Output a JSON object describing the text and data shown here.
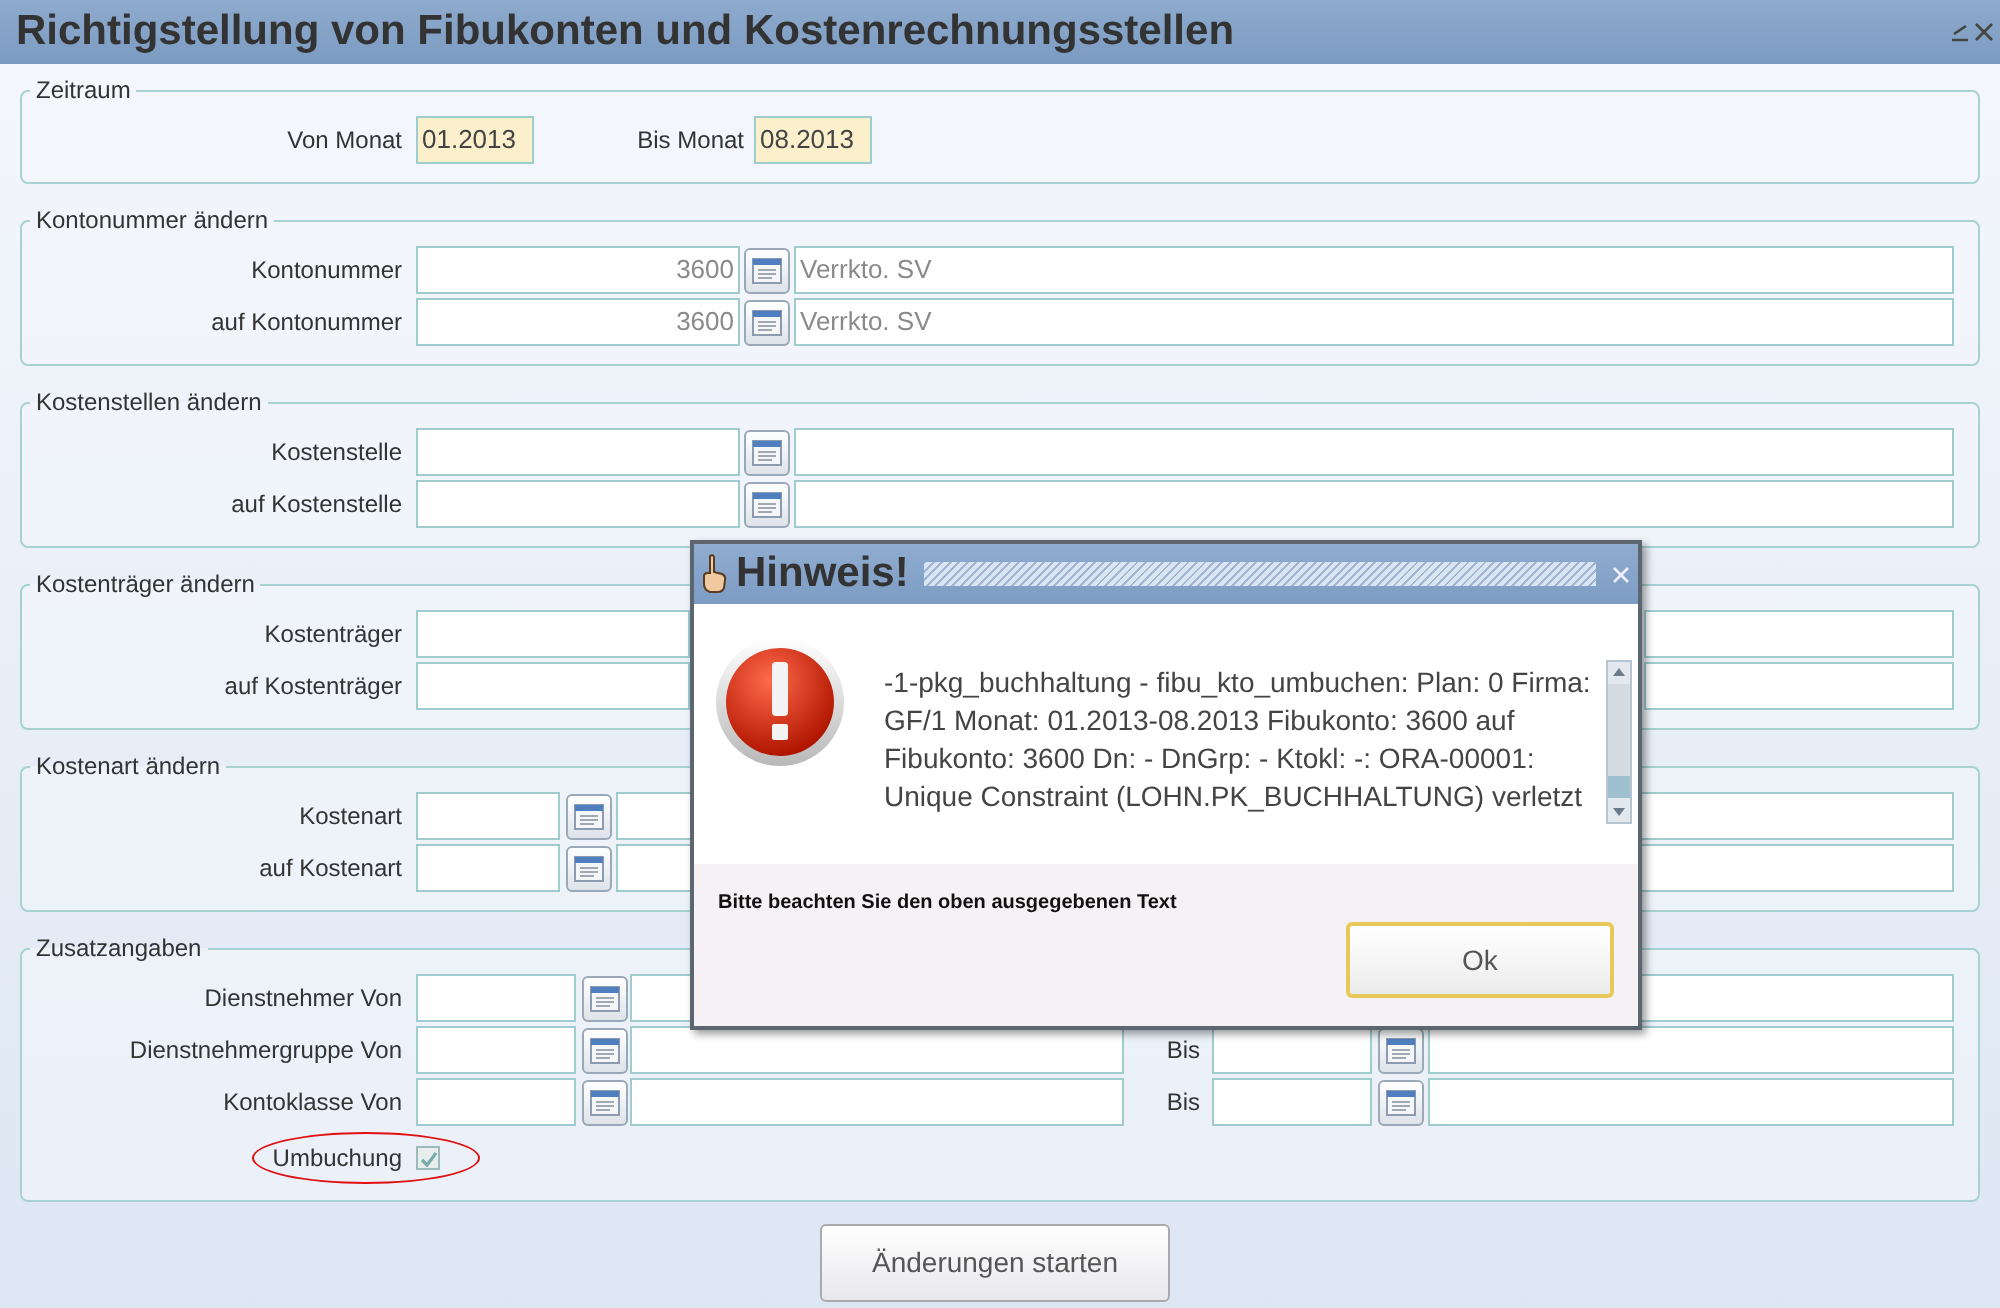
{
  "window": {
    "title": "Richtigstellung von Fibukonten und Kostenrechnungsstellen"
  },
  "period": {
    "legend": "Zeitraum",
    "from_label": "Von Monat",
    "from_value": "01.2013",
    "to_label": "Bis Monat",
    "to_value": "08.2013"
  },
  "sections": [
    {
      "legend": "Kontonummer ändern",
      "rows": [
        {
          "kind": "wide",
          "label": "Kontonummer",
          "code": "3600",
          "description": "Verrkto. SV"
        },
        {
          "kind": "wide",
          "label": "auf Kontonummer",
          "code": "3600",
          "description": "Verrkto. SV"
        }
      ]
    },
    {
      "legend": "Kostenstellen ändern",
      "rows": [
        {
          "kind": "wide",
          "label": "Kostenstelle"
        },
        {
          "kind": "wide",
          "label": "auf Kostenstelle"
        }
      ]
    },
    {
      "legend": "Kostenträger ändern",
      "rows": [
        {
          "kind": "plain",
          "label": "Kostenträger"
        },
        {
          "kind": "plain",
          "label": "auf Kostenträger"
        }
      ]
    },
    {
      "legend": "Kostenart ändern",
      "rows": [
        {
          "kind": "short",
          "label": "Kostenart"
        },
        {
          "kind": "short",
          "label": "auf Kostenart"
        }
      ]
    },
    {
      "legend": "Zusatzangaben",
      "rows": [
        {
          "kind": "range",
          "label": "Dienstnehmer Von"
        },
        {
          "kind": "range",
          "label": "Dienstnehmergruppe Von",
          "to_label": "Bis"
        },
        {
          "kind": "range",
          "label": "Kontoklasse Von",
          "to_label": "Bis"
        }
      ]
    }
  ],
  "checkbox": {
    "label": "Umbuchung",
    "checked": true,
    "circled": true
  },
  "start_button": "Änderungen starten",
  "dialog": {
    "title": "Hinweis!",
    "message": "-1-pkg_buchhaltung - fibu_kto_umbuchen: Plan: 0 Firma: GF/1 Monat: 01.2013-08.2013 Fibukonto: 3600 auf Fibukonto: 3600 Dn: - DnGrp: - Ktokl: -: ORA-00001: Unique Constraint (LOHN.PK_BUCHHALTUNG) verletzt",
    "note": "Bitte beachten Sie den oben ausgegebenen Text",
    "ok_button": "Ok"
  }
}
